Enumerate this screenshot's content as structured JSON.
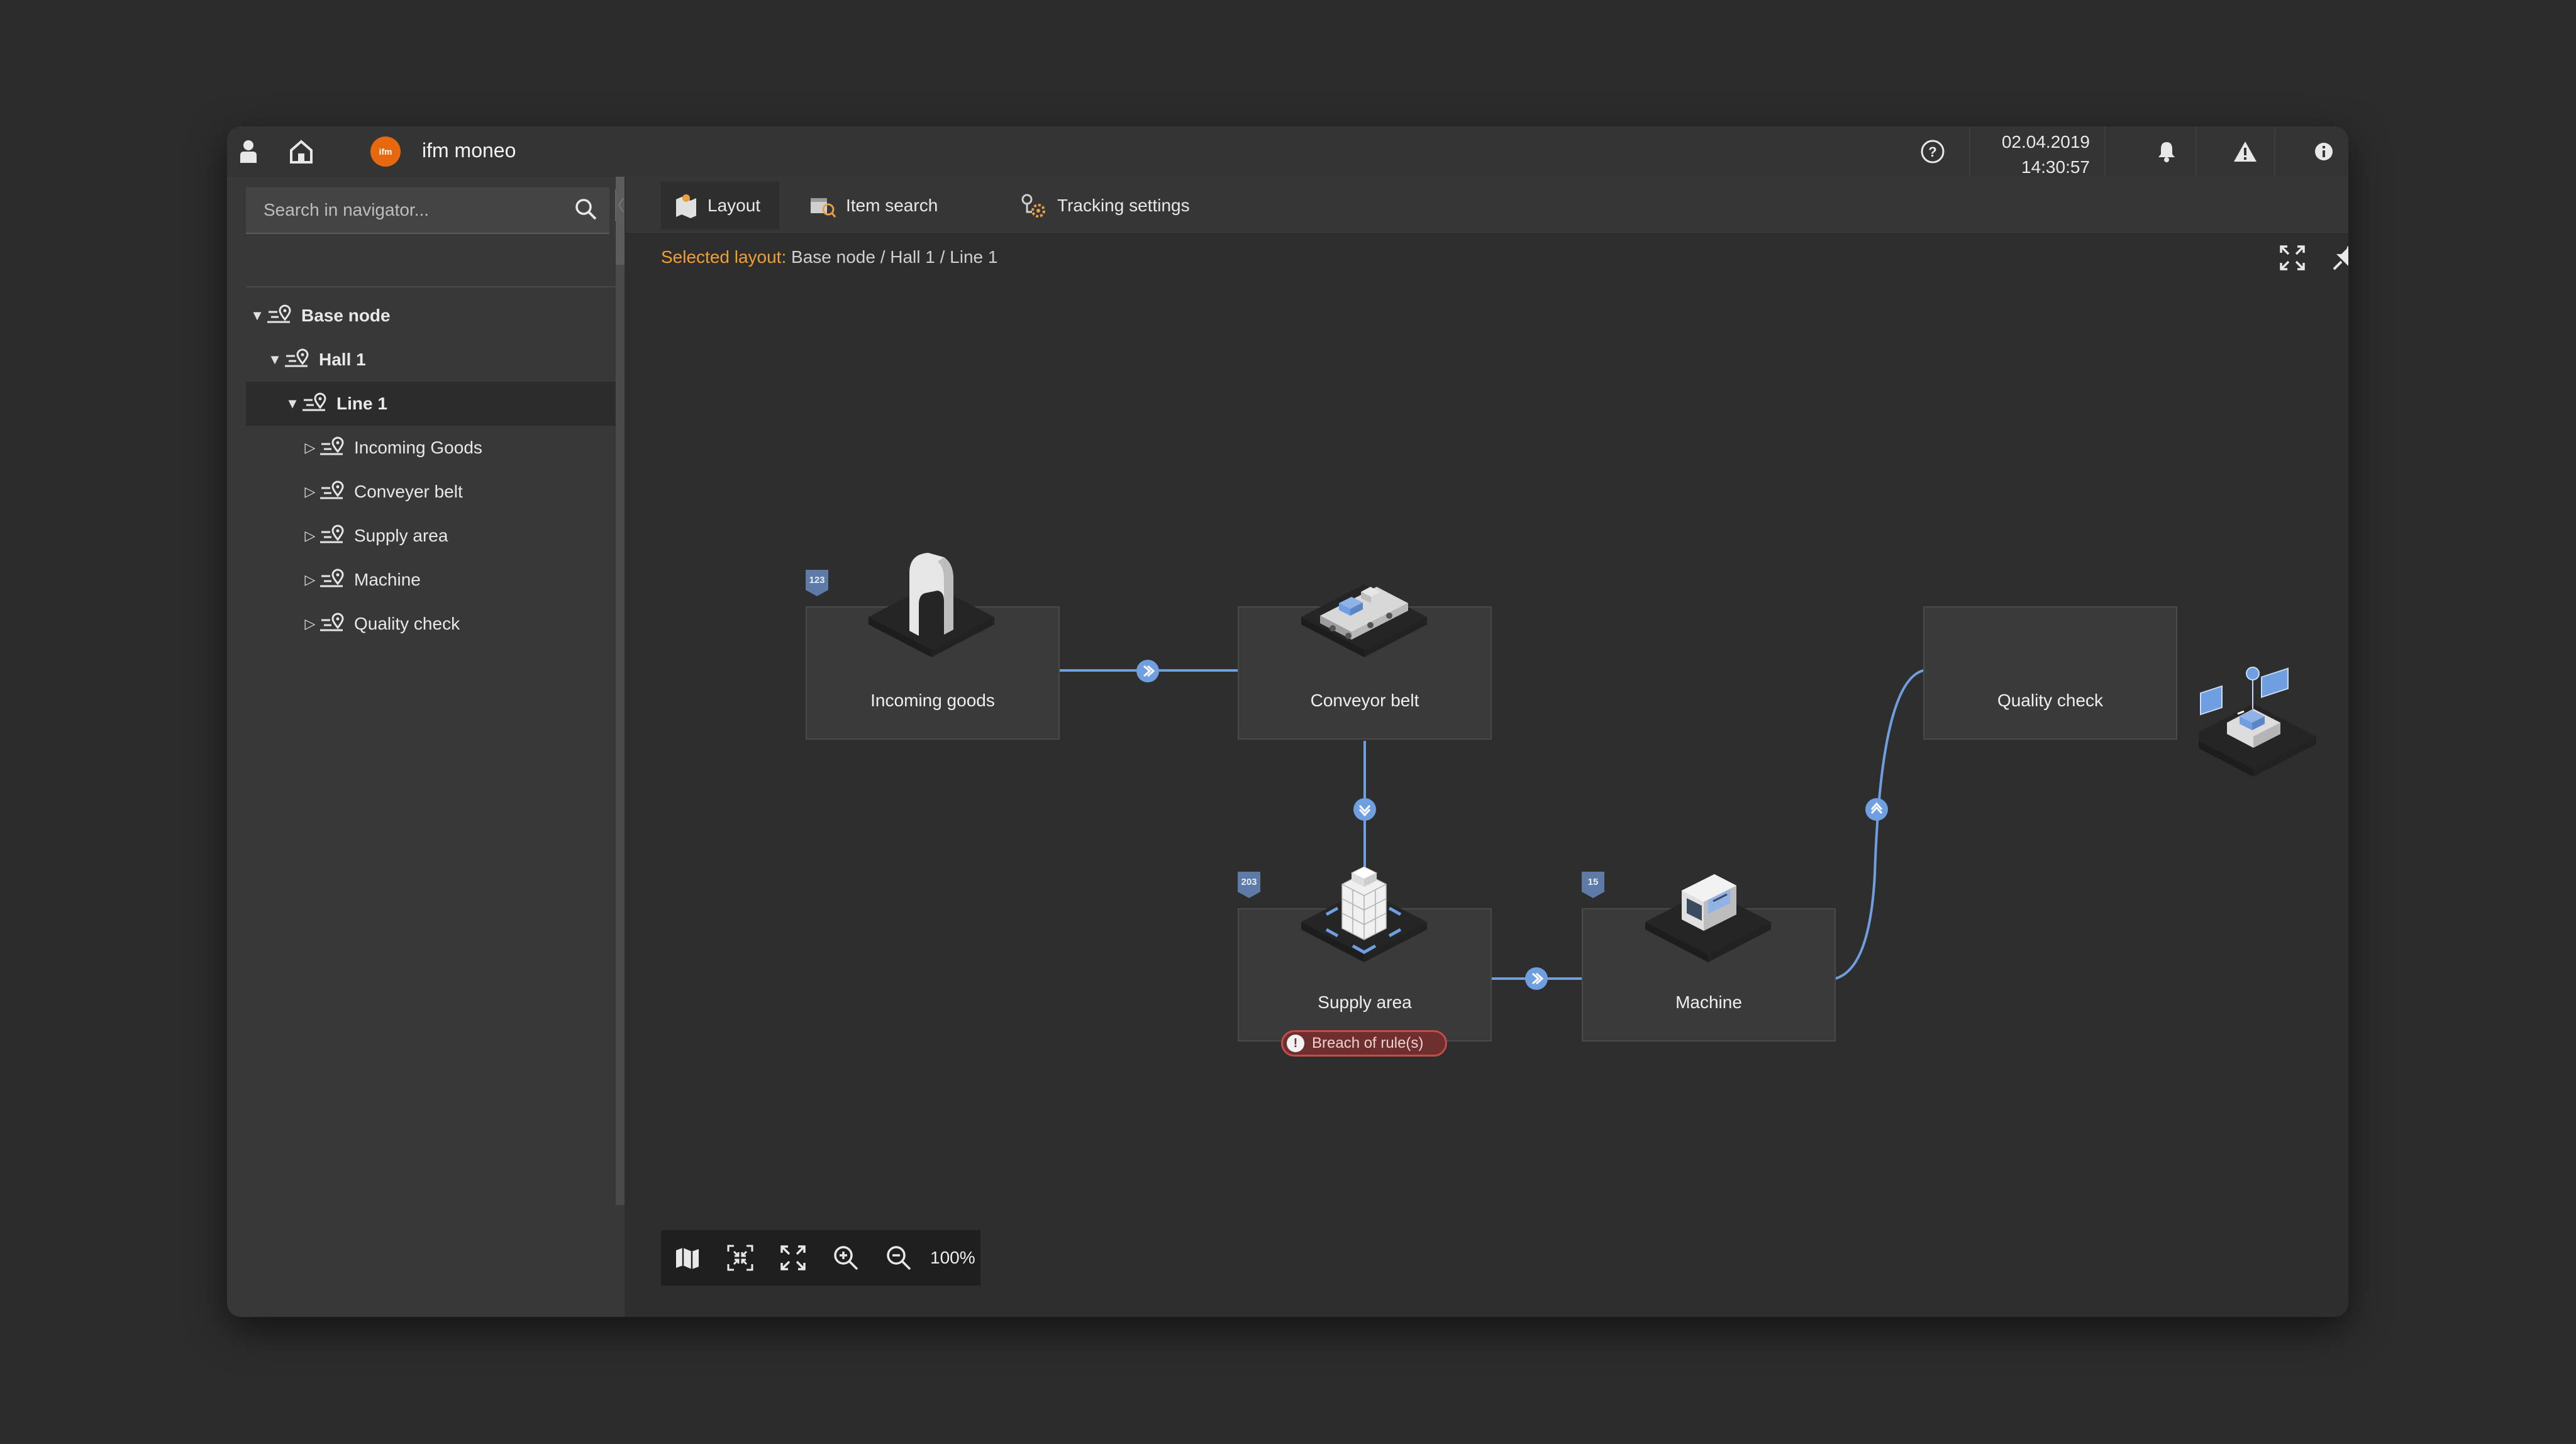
{
  "app": {
    "title": "ifm moneo",
    "logo_text": "ifm",
    "date": "02.04.2019",
    "time": "14:30:57",
    "icons": [
      "user-icon",
      "home-icon",
      "help-icon",
      "bell-icon",
      "warning-icon",
      "info-icon"
    ]
  },
  "navigator": {
    "search_placeholder": "Search in navigator...",
    "tree": [
      {
        "label": "Base node",
        "level": 0,
        "expanded": true,
        "bold": true
      },
      {
        "label": "Hall 1",
        "level": 1,
        "expanded": true,
        "bold": true
      },
      {
        "label": "Line 1",
        "level": 2,
        "expanded": true,
        "bold": true,
        "selected": true
      },
      {
        "label": "Incoming Goods",
        "level": 3,
        "expanded": false
      },
      {
        "label": "Conveyer belt",
        "level": 3,
        "expanded": false
      },
      {
        "label": "Supply area",
        "level": 3,
        "expanded": false
      },
      {
        "label": "Machine",
        "level": 3,
        "expanded": false
      },
      {
        "label": "Quality check",
        "level": 3,
        "expanded": false
      }
    ]
  },
  "tabs": [
    {
      "label": "Layout",
      "active": true,
      "icon": "layout-map-icon"
    },
    {
      "label": "Item search",
      "active": false,
      "icon": "item-search-icon"
    },
    {
      "label": "Tracking settings",
      "active": false,
      "icon": "tracking-settings-icon"
    }
  ],
  "breadcrumb": {
    "key": "Selected layout:",
    "value": "Base node / Hall 1 / Line 1"
  },
  "toolbar_icons": [
    "fullscreen-icon",
    "pin-icon",
    "edit-icon",
    "delete-icon"
  ],
  "layout": {
    "nodes": [
      {
        "label": "Incoming goods",
        "badge": "123"
      },
      {
        "label": "Conveyor belt",
        "badge": null
      },
      {
        "label": "Supply area",
        "badge": "203",
        "alert": "Breach of rule(s)"
      },
      {
        "label": "Machine",
        "badge": "15"
      },
      {
        "label": "Quality check",
        "badge": null
      }
    ],
    "accent": "#6f9fe0",
    "alert_color": "#c54a4a"
  },
  "zoom": {
    "level": "100%",
    "buttons": [
      "map-icon",
      "fit-to-screen-icon",
      "expand-icon",
      "zoom-in-icon",
      "zoom-out-icon"
    ]
  }
}
